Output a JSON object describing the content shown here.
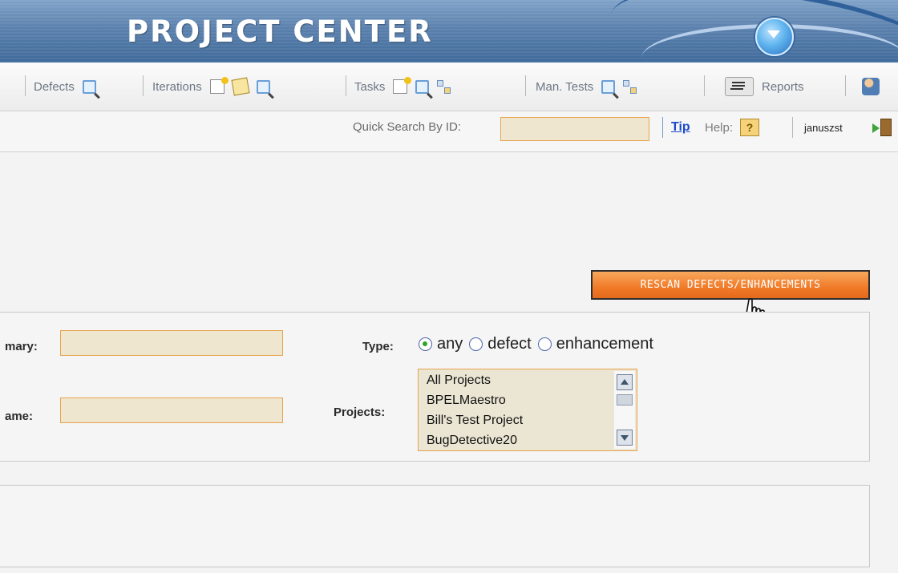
{
  "header": {
    "title": "PROJECT CENTER"
  },
  "nav": {
    "defects": "Defects",
    "iterations": "Iterations",
    "tasks": "Tasks",
    "man_tests": "Man. Tests",
    "reports": "Reports"
  },
  "toolbar": {
    "quick_search_label": "Quick Search By ID:",
    "quick_search_value": "",
    "tip": "Tip",
    "help_label": "Help:",
    "help_icon": "?",
    "username": "januszst"
  },
  "actions": {
    "rescan_label": "RESCAN DEFECTS/ENHANCEMENTS"
  },
  "filters": {
    "summary_label": "mary:",
    "summary_value": "",
    "name_label": "ame:",
    "name_value": "",
    "type_label": "Type:",
    "type_options": [
      "any",
      "defect",
      "enhancement"
    ],
    "type_selected": "any",
    "projects_label": "Projects:",
    "projects": [
      "All Projects",
      "BPELMaestro",
      "Bill's Test Project",
      "BugDetective20"
    ]
  },
  "colors": {
    "accent_orange": "#f07a28",
    "field_border": "#e8a24d",
    "link_blue": "#1d49c8",
    "banner_blue": "#5a80ad"
  },
  "icons": {
    "banner_menu": "chevron-down-orb-icon",
    "search": "magnifier-icon",
    "new": "new-document-icon",
    "tree": "hierarchy-icon",
    "report": "report-list-icon",
    "user": "user-settings-icon",
    "logout": "exit-door-icon"
  }
}
